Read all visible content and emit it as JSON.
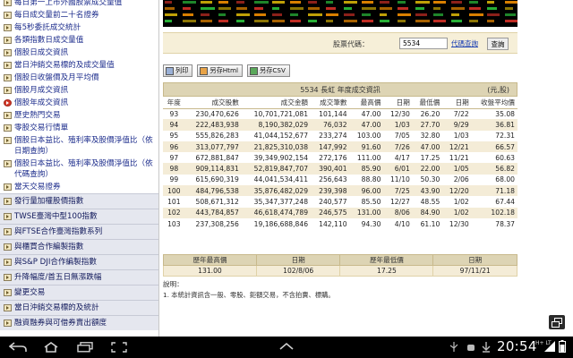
{
  "sidebar": {
    "items": [
      {
        "label": "每日第一上市外國股票成交量值",
        "bullet": "normal"
      },
      {
        "label": "每日成交量前二十名證券",
        "bullet": "normal"
      },
      {
        "label": "每5秒委託成交統計",
        "bullet": "normal"
      },
      {
        "label": "各類指數日成交量值",
        "bullet": "normal"
      },
      {
        "label": "個股日成交資訊",
        "bullet": "normal"
      },
      {
        "label": "當日沖銷交易標的及成交量值",
        "bullet": "normal"
      },
      {
        "label": "個股日收盤價及月平均價",
        "bullet": "normal"
      },
      {
        "label": "個股月成交資訊",
        "bullet": "normal"
      },
      {
        "label": "個股年成交資訊",
        "bullet": "red"
      },
      {
        "label": "歷史熱門交易",
        "bullet": "normal"
      },
      {
        "label": "零股交易行情單",
        "bullet": "normal"
      },
      {
        "label": "個股日本益比、殖利率及股價淨值比（依日期查詢）",
        "bullet": "normal"
      },
      {
        "label": "個股日本益比、殖利率及股價淨值比（依代碼查詢）",
        "bullet": "normal"
      },
      {
        "label": "當天交易證券",
        "bullet": "normal"
      },
      {
        "label": "發行量加權股價指數",
        "bullet": "normal",
        "group": true
      },
      {
        "label": "TWSE臺灣中型100指數",
        "bullet": "normal",
        "group": true
      },
      {
        "label": "與FTSE合作臺灣指數系列",
        "bullet": "normal",
        "group": true
      },
      {
        "label": "與櫃買合作編製指數",
        "bullet": "normal",
        "group": true
      },
      {
        "label": "與S&P DJI合作編製指數",
        "bullet": "normal",
        "group": true
      },
      {
        "label": "升降幅度/首五日無漲跌幅",
        "bullet": "normal",
        "group": true
      },
      {
        "label": "變更交易",
        "bullet": "normal",
        "group": true
      },
      {
        "label": "當日沖銷交易標的及統計",
        "bullet": "normal",
        "group": true
      },
      {
        "label": "融資融券與可借券賣出額度",
        "bullet": "normal",
        "group": true
      }
    ]
  },
  "search": {
    "label": "股票代碼：",
    "value": "5534",
    "lookup_link": "代碼查詢",
    "query_button": "查詢"
  },
  "toolbar": {
    "print_label": "列印",
    "save_html_label": "另存Html",
    "save_csv_label": "另存CSV"
  },
  "table": {
    "title": "5534 長虹 年度成交資訊",
    "unit": "(元,股)",
    "headers": [
      "年度",
      "成交股數",
      "成交金額",
      "成交筆數",
      "最高價",
      "日期",
      "最低價",
      "日期",
      "收盤平均價"
    ],
    "rows": [
      [
        "93",
        "230,470,626",
        "10,701,721,081",
        "101,144",
        "47.00",
        "12/30",
        "26.20",
        "7/22",
        "35.08"
      ],
      [
        "94",
        "222,483,938",
        "8,190,382,029",
        "76,032",
        "47.00",
        "1/03",
        "27.70",
        "9/29",
        "36.81"
      ],
      [
        "95",
        "555,826,283",
        "41,044,152,677",
        "233,274",
        "103.00",
        "7/05",
        "32.80",
        "1/03",
        "72.31"
      ],
      [
        "96",
        "313,077,797",
        "21,825,310,038",
        "147,992",
        "91.60",
        "7/26",
        "47.00",
        "12/21",
        "66.57"
      ],
      [
        "97",
        "672,881,847",
        "39,349,902,154",
        "272,176",
        "111.00",
        "4/17",
        "17.25",
        "11/21",
        "60.63"
      ],
      [
        "98",
        "909,114,831",
        "52,819,847,707",
        "390,401",
        "85.90",
        "6/01",
        "22.00",
        "1/05",
        "56.82"
      ],
      [
        "99",
        "615,690,319",
        "44,041,534,411",
        "256,643",
        "88.80",
        "11/10",
        "50.30",
        "2/06",
        "68.00"
      ],
      [
        "100",
        "484,796,538",
        "35,876,482,029",
        "239,398",
        "96.00",
        "7/25",
        "43.90",
        "12/20",
        "71.18"
      ],
      [
        "101",
        "508,671,312",
        "35,347,377,248",
        "240,577",
        "85.50",
        "12/27",
        "48.55",
        "1/02",
        "67.44"
      ],
      [
        "102",
        "443,784,857",
        "46,618,474,789",
        "246,575",
        "131.00",
        "8/06",
        "84.90",
        "1/02",
        "102.18"
      ],
      [
        "103",
        "237,308,256",
        "19,186,688,846",
        "142,110",
        "94.30",
        "4/10",
        "61.10",
        "12/30",
        "78.37"
      ]
    ]
  },
  "summary": {
    "headers": [
      "歷年最高價",
      "日期",
      "歷年最低價",
      "日期"
    ],
    "values": [
      "131.00",
      "102/8/06",
      "17.25",
      "97/11/21"
    ]
  },
  "note": {
    "title": "說明：",
    "text": "1. 本統計資訊含一般、零股、鉅額交易，不含拍賣、標購。"
  },
  "system": {
    "clock": "20:54",
    "net_label": "H+ LT"
  },
  "colors": {
    "accent_tan": "#ddd4b4",
    "row_alt": "#f4ecd7",
    "nav_text": "#1d2d8c",
    "link": "#1a3fb3"
  }
}
